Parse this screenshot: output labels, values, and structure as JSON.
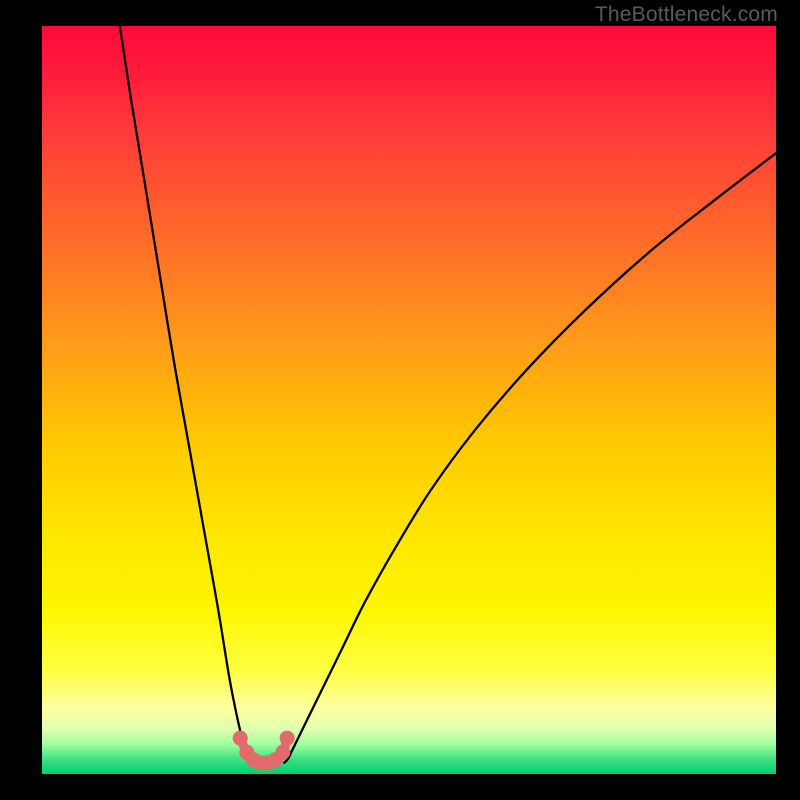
{
  "watermark": "TheBottleneck.com",
  "chart_data": {
    "type": "line",
    "title": "",
    "xlabel": "",
    "ylabel": "",
    "xlim": [
      0,
      100
    ],
    "ylim": [
      0,
      100
    ],
    "series": [
      {
        "name": "curve-left",
        "x": [
          10.6,
          12,
          14,
          16,
          18,
          20,
          22,
          24,
          25.5,
          26.5,
          27.2,
          27.8,
          28.3,
          28.8
        ],
        "y": [
          100,
          91,
          79,
          67,
          55,
          44,
          33,
          22,
          13,
          8,
          5,
          3,
          2,
          1.5
        ]
      },
      {
        "name": "curve-right",
        "x": [
          33,
          33.5,
          34,
          35,
          36.5,
          38.5,
          41,
          44,
          48,
          53,
          59,
          66,
          74,
          83,
          92,
          100
        ],
        "y": [
          1.5,
          2,
          3,
          5,
          8,
          12,
          17,
          23,
          30,
          38,
          46,
          54,
          62,
          70,
          77,
          83
        ]
      },
      {
        "name": "valley-dots",
        "x": [
          27.0,
          27.9,
          28.8,
          29.8,
          30.8,
          31.8,
          32.8,
          33.4
        ],
        "y": [
          4.8,
          2.9,
          1.9,
          1.5,
          1.5,
          1.9,
          2.9,
          4.8
        ]
      }
    ],
    "background_gradient": {
      "stops": [
        {
          "pos": 0,
          "color": "#ff0a3a"
        },
        {
          "pos": 50,
          "color": "#ffca00"
        },
        {
          "pos": 90,
          "color": "#ffff80"
        },
        {
          "pos": 100,
          "color": "#00d070"
        }
      ]
    }
  }
}
